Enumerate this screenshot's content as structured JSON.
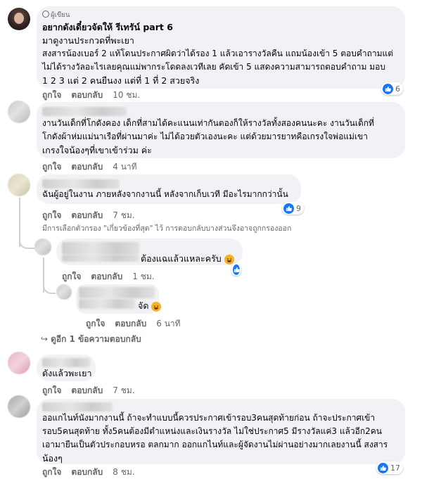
{
  "top_comment": {
    "badge": "ผู้เขียน",
    "author": "อยากดังเดี๋ยวจัดให้ รีเทรัน์ part 6",
    "lines": [
      "มาดูงานประกวดที่พะเยา",
      "สงสารน้องเบอร์ 2 แท้โดนประกาศผิดว่าได้รอง 1 แล้วเอารางวัลคืน แถมน้องเข้า 5 ตอบคำถามแต่",
      "ไม่ได้รางวัลอะไรเลยคุณแม่พากระโดดลงเวทีเลย คัดเข้า 5 แสดงความสามารถตอบคำถาม มอบ",
      "1 2 3 แต่ 2 คนยืนงง แต่ที่ 1 ที่ 2 สวยจริง"
    ],
    "like": "ถูกใจ",
    "reply": "ตอบกลับ",
    "time": "10 ชม.",
    "reactions": "6"
  },
  "comment2": {
    "lines": [
      "งานวันเด็กที่โกดังคอง เด็กที่สามได้คะแนนเท่ากันตองก็ให้รางวัลทั้งสองคนนะคะ งานวันเด็กที่",
      "โกดังผ้าห่มแม่นาเรือที่ผ่านมาค่ะ ไม่ได้อวยตัวเองนะคะ แต่ด้วยมารยาทคือเกรงใจพ่อแม่เขา",
      "เกรงใจน้องๆที่เขาเข้าร่วม ค่ะ"
    ],
    "like": "ถูกใจ",
    "reply": "ตอบกลับ",
    "time": "4 นาที"
  },
  "comment3": {
    "text": "ฉันผู้อยู่ในงาน ภายหลังจากงานนี้ หลังจากเก็บเวที มีอะไรมากกว่านั้น",
    "like": "ถูกใจ",
    "reply": "ตอบกลับ",
    "time": "7 ชม.",
    "reactions": "9"
  },
  "filter_notice": "มีการเลือกตัวกรอง \"เกี่ยวข้องที่สุด\" ไว้ การตอบกลับบางส่วนจึงอาจถูกกรองออก",
  "reply1": {
    "text": "ต้องแฉแล้วแหละครับ",
    "like": "ถูกใจ",
    "reply": "ตอบกลับ",
    "time": "1 ชม."
  },
  "reply2": {
    "text": "จัด",
    "like": "ถูกใจ",
    "reply": "ตอบกลับ",
    "time": "6 นาที"
  },
  "view_replies": "ดูอีก 1 ข้อความตอบกลับ",
  "comment4": {
    "text": "ดังแล้วพะเยา",
    "like": "ถูกใจ",
    "reply": "ตอบกลับ",
    "time": "7 ชม."
  },
  "comment5": {
    "lines": [
      "ออแกไนท์นังมากงานนี้ ถ้าจะทำแบบนี้ควรประกาศเข้ารอบ3คนสุดท้ายก่อน ถ้าจะประกาศเข้า",
      "รอบ5คนสุดท้าย ทั้ง5คนต้องมีตำแหน่งและเงินรางวัล ไม่ใช่ประกาศ5 มีรางวัลแค่3 แล้วอีก2คน",
      "เอามายืนเป็นตัวประกอบหรอ ตลกมาก ออกแกไนท์และผู้จัดงานไม่ผ่านอย่างมากเลยงานนี้ สงสาร",
      "น้องๆ"
    ],
    "like": "ถูกใจ",
    "reply": "ตอบกลับ",
    "time": "8 ชม.",
    "reactions": "17"
  },
  "colors": {
    "like_blue": "#1877f2",
    "bubble": "#f0f2f5",
    "meta": "#65676b"
  }
}
